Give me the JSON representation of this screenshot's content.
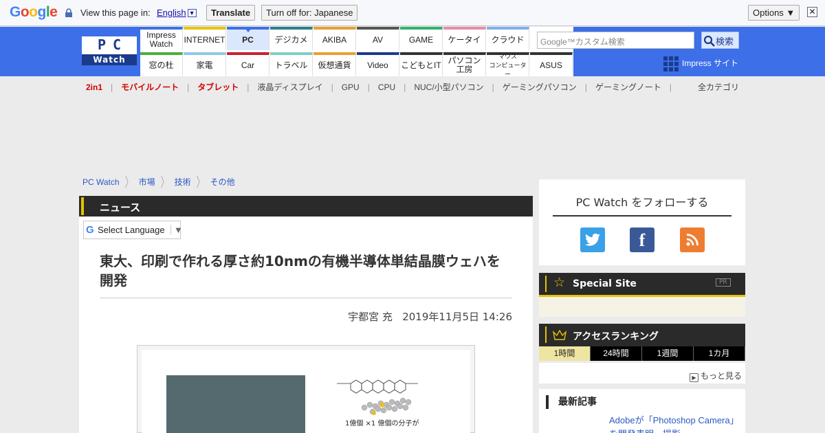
{
  "translate_bar": {
    "logo": "Google",
    "label": "View this page in:",
    "language": "English",
    "translate_button": "Translate",
    "turn_off_button": "Turn off for: Japanese",
    "options_button": "Options ▼",
    "close": "✕"
  },
  "logo": {
    "top": "PC",
    "bottom": "Watch"
  },
  "nav": {
    "row1": [
      {
        "label": "Impress\nWatch",
        "color": "#3c6fe8"
      },
      {
        "label": "INTERNET",
        "color": "#e8c400"
      },
      {
        "label": "PC",
        "color": "#3c6fe8",
        "selected": true
      },
      {
        "label": "デジカメ",
        "color": "#2a7f8c"
      },
      {
        "label": "AKIBA",
        "color": "#e8a030"
      },
      {
        "label": "AV",
        "color": "#555555"
      },
      {
        "label": "GAME",
        "color": "#2fb36e"
      },
      {
        "label": "ケータイ",
        "color": "#e88aa5"
      },
      {
        "label": "クラウド",
        "color": "#7fb0e8"
      }
    ],
    "row2": [
      {
        "label": "窓の杜",
        "color": "#4caf3a"
      },
      {
        "label": "家電",
        "color": "#8fc8e8"
      },
      {
        "label": "Car",
        "color": "#c82030"
      },
      {
        "label": "トラベル",
        "color": "#7fd0c0"
      },
      {
        "label": "仮想通貨",
        "color": "#e8a030"
      },
      {
        "label": "Video",
        "color": "#1a3a8c"
      },
      {
        "label": "こどもとIT",
        "color": "#333333"
      },
      {
        "label": "パソコン\n工房",
        "color": "#333333"
      },
      {
        "label": "マウス\nコンピューター",
        "color": "#333333"
      },
      {
        "label": "ASUS",
        "color": "#333333"
      }
    ]
  },
  "search": {
    "placeholder": "Google™カスタム検索",
    "button": "検索"
  },
  "impress_site": "Impress サイト",
  "categories": [
    {
      "label": "2in1",
      "highlight": true
    },
    {
      "label": "モバイルノート",
      "highlight": true
    },
    {
      "label": "タブレット",
      "highlight": true
    },
    {
      "label": "液晶ディスプレイ",
      "highlight": false
    },
    {
      "label": "GPU",
      "highlight": false
    },
    {
      "label": "CPU",
      "highlight": false
    },
    {
      "label": "NUC/小型パソコン",
      "highlight": false
    },
    {
      "label": "ゲーミングパソコン",
      "highlight": false
    },
    {
      "label": "ゲーミングノート",
      "highlight": false
    }
  ],
  "all_categories": "全カテゴリ",
  "breadcrumb": [
    "PC Watch",
    "市場",
    "技術",
    "その他"
  ],
  "section_title": "ニュース",
  "language_select": "Select Language",
  "article": {
    "title": "東大、印刷で作れる厚さ約10nmの有機半導体単結晶膜ウェハを開発",
    "author": "宇都宮 充",
    "date": "2019年11月5日 14:26",
    "figure_caption": "1億個 ×1 億個の分子が"
  },
  "sidebar": {
    "follow_title": "PC Watch をフォローする",
    "special_site": "Special Site",
    "pr": "PR",
    "ranking_title": "アクセスランキング",
    "ranking_tabs": [
      "1時間",
      "24時間",
      "1週間",
      "1カ月"
    ],
    "more": "もっと見る",
    "latest_title": "最新記事",
    "latest_link": "Adobeが「Photoshop Camera」を開発表明、撮影"
  }
}
